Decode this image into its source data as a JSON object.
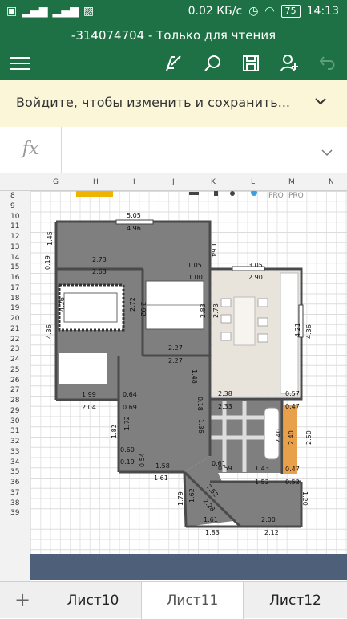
{
  "status_bar": {
    "network_speed": "0.02 КБ/с",
    "battery": "75",
    "time": "14:13"
  },
  "title_bar": {
    "title": "-314074704 - Только для чтения"
  },
  "toolbar": {
    "icons": [
      "menu-icon",
      "pen-icon",
      "search-icon",
      "save-icon",
      "share-user-icon",
      "undo-icon"
    ]
  },
  "banner": {
    "text": "Войдите, чтобы изменить и сохранить..."
  },
  "formula_bar": {
    "fx_label": "fx",
    "value": ""
  },
  "column_headers": [
    "G",
    "H",
    "I",
    "J",
    "K",
    "L",
    "M",
    "N"
  ],
  "row_headers": [
    "8",
    "9",
    "10",
    "11",
    "12",
    "13",
    "14",
    "15",
    "16",
    "17",
    "18",
    "19",
    "20",
    "21",
    "22",
    "23",
    "24",
    "25",
    "26",
    "27",
    "28",
    "29",
    "30",
    "31",
    "32",
    "33",
    "34",
    "35",
    "36",
    "37",
    "38",
    "39"
  ],
  "floorplan": {
    "pro_labels": [
      "PRO",
      "PRO"
    ],
    "dimensions": [
      "5.05",
      "4.96",
      "1.45",
      "0.19",
      "2.73",
      "2.63",
      "1.05",
      "1.64",
      "3.05",
      "2.90",
      "1.00",
      "4.36",
      "4.26",
      "2.72",
      "2.92",
      "2.73",
      "2.83",
      "4.21",
      "4.36",
      "2.27",
      "2.27",
      "1.48",
      "1.99",
      "0.64",
      "2.04",
      "0.69",
      "1.72",
      "1.82",
      "0.18",
      "1.36",
      "2.38",
      "0.57",
      "2.33",
      "0.47",
      "2.40",
      "2.50",
      "2.40",
      "0.60",
      "0.54",
      "0.19",
      "1.58",
      "1.43",
      "0.47",
      "1.61",
      "2.52",
      "1.52",
      "0.52",
      "1.79",
      "1.62",
      "2.28",
      "1.20",
      "1.61",
      "2.00",
      "1.83",
      "2.12",
      "0.61",
      "0.59"
    ]
  },
  "sheet_tabs": {
    "add_label": "+",
    "tabs": [
      "Лист10",
      "Лист11",
      "Лист12"
    ],
    "active": "Лист11"
  },
  "colors": {
    "excel_green": "#1e7145",
    "banner_bg": "#fbf6d8",
    "room_fill": "#808080",
    "wall": "#4a4a4a"
  }
}
